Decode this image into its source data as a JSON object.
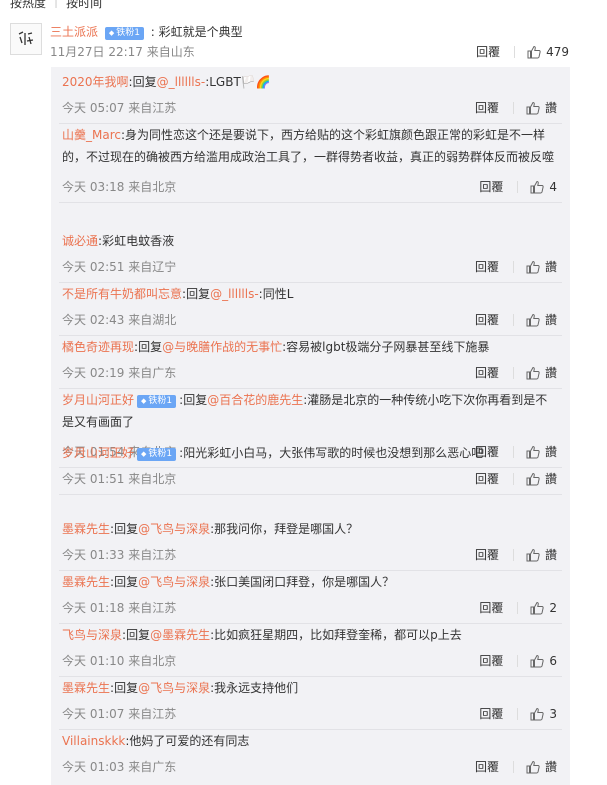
{
  "sort_tabs": [
    "按热度",
    "按时间"
  ],
  "labels": {
    "reply": "回覆",
    "like": "讚",
    "colon": ":",
    "reply_prefix": "回复"
  },
  "main": {
    "user": "三土派派",
    "badge": "铁粉1",
    "text": "彩虹就是个典型",
    "time": "11月27日 22:17 来自山东",
    "reply": "回覆",
    "likes": "479",
    "avatar_icon": "avatar-sketch"
  },
  "replies": [
    {
      "user": "2020年我啊",
      "badge": "",
      "to": "@_lllllls-",
      "text": "LGBT🏳️🌈",
      "time": "今天 05:07 来自江苏",
      "likes": "讚"
    },
    {
      "user": "山羹_Marc",
      "badge": "",
      "to": "",
      "text": "身为同性恋这个还是要说下，西方给贴的这个彩虹旗颜色跟正常的彩虹是不一样的，不过现在的确被西方给滥用成政治工具了，一群得势者收益，真正的弱势群体反而被反噬",
      "time": "今天 03:18 来自北京",
      "likes": "4"
    },
    {
      "user": "诚必通",
      "badge": "",
      "to": "",
      "text": "彩虹电蚊香液",
      "time": "今天 02:51 来自辽宁",
      "likes": "讚"
    },
    {
      "user": "不是所有牛奶都叫忘意",
      "badge": "",
      "to": "@_lllllls-",
      "text": "同性L",
      "time": "今天 02:43 来自湖北",
      "likes": "讚"
    },
    {
      "user": "橘色奇迹再现",
      "badge": "",
      "to": "@与晚膳作战的无事忙",
      "text": "容易被lgbt极端分子网暴甚至线下施暴",
      "time": "今天 02:19 来自广东",
      "likes": "讚"
    },
    {
      "user": "岁月山河正好",
      "badge": "铁粉1",
      "to": "@百合花的鹿先生",
      "text": "灌肠是北京的一种传统小吃下次你再看到是不是又有画面了",
      "time": "今天 01:54 来自北京",
      "likes": "讚"
    },
    {
      "user": "岁月山河正好",
      "badge": "铁粉1",
      "to": "",
      "text": "阳光彩虹小白马，大张伟写歌的时候也没想到那么恶心吧",
      "time": "今天 01:51 来自北京",
      "likes": "讚"
    },
    {
      "user": "墨霖先生",
      "badge": "",
      "to": "@飞鸟与深泉",
      "text": "那我问你，拜登是哪国人？",
      "time": "今天 01:33 来自江苏",
      "likes": "讚"
    },
    {
      "user": "墨霖先生",
      "badge": "",
      "to": "@飞鸟与深泉",
      "text": "张口美国闭口拜登，你是哪国人？",
      "time": "今天 01:18 来自江苏",
      "likes": "2"
    },
    {
      "user": "飞鸟与深泉",
      "badge": "",
      "to": "@墨霖先生",
      "text": "比如疯狂星期四，比如拜登奎稀，都可以p上去",
      "time": "今天 01:10 来自北京",
      "likes": "6"
    },
    {
      "user": "墨霖先生",
      "badge": "",
      "to": "@飞鸟与深泉",
      "text": "我永远支持他们",
      "time": "今天 01:07 来自江苏",
      "likes": "3"
    },
    {
      "user": "Villainskkk",
      "badge": "",
      "to": "",
      "text": "他妈了可爱的还有同志",
      "time": "今天 01:03 来自广东",
      "likes": "讚"
    }
  ]
}
